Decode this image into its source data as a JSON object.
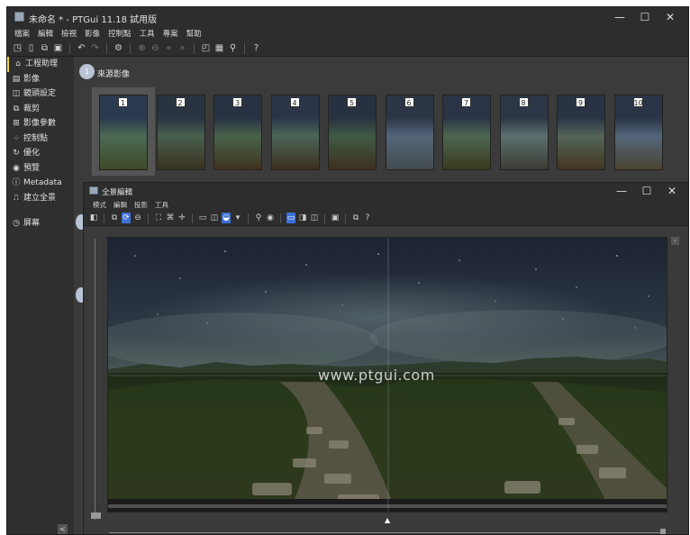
{
  "window": {
    "title": "未命名 * - PTGui 11.18 試用版",
    "controls": {
      "minimize": "—",
      "maximize": "☐",
      "close": "✕"
    }
  },
  "menu": [
    "檔案",
    "編輯",
    "檢視",
    "影像",
    "控制點",
    "工具",
    "專案",
    "幫助"
  ],
  "toolbar": {
    "icons": [
      "new-icon",
      "save-icon",
      "copy-icon",
      "save-as-icon",
      "undo-icon",
      "redo-icon",
      "settings-icon",
      "zoom-in-icon",
      "zoom-out-icon",
      "prev-icon",
      "next-icon",
      "panorama-editor-icon",
      "grid-icon",
      "pin-icon",
      "help-icon"
    ]
  },
  "sidebar": {
    "items": [
      {
        "label": "工程助理",
        "icon": "⌂",
        "active": true
      },
      {
        "label": "影像",
        "icon": "▤"
      },
      {
        "label": "鏡頭設定",
        "icon": "◫"
      },
      {
        "label": "裁剪",
        "icon": "⧉"
      },
      {
        "label": "影像參數",
        "icon": "⊞"
      },
      {
        "label": "控制點",
        "icon": "⁘"
      },
      {
        "label": "優化",
        "icon": "↻"
      },
      {
        "label": "預覽",
        "icon": "◉"
      },
      {
        "label": "Metadata",
        "icon": "ⓘ"
      },
      {
        "label": "建立全景",
        "icon": "⎍"
      }
    ],
    "extra": {
      "label": "屏幕",
      "icon": "◷"
    },
    "collapse": "<"
  },
  "main": {
    "step1": {
      "number": "1",
      "title": "來源影像"
    },
    "thumbnails": [
      "1",
      "2",
      "3",
      "4",
      "5",
      "6",
      "7",
      "8",
      "9",
      "10"
    ]
  },
  "editor": {
    "title": "全景編輯",
    "menu": [
      "模式",
      "編輯",
      "投影",
      "工具"
    ],
    "watermark": "www.ptgui.com",
    "slider_mark": "▲"
  },
  "colors": {
    "accent": "#3d6fd6",
    "active_marker": "#f1d147"
  }
}
